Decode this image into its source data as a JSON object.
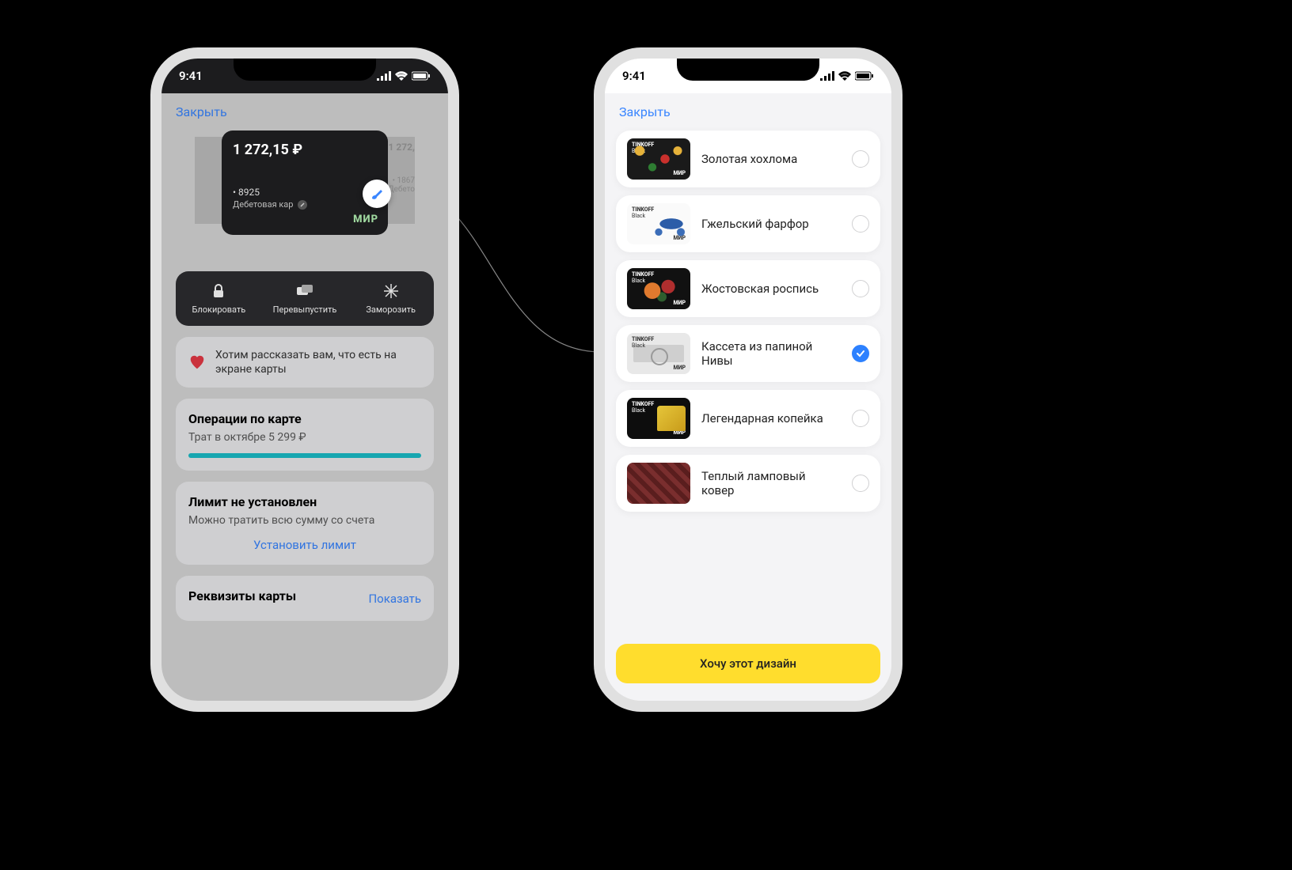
{
  "status": {
    "time": "9:41"
  },
  "close_label": "Закрыть",
  "phone1": {
    "card": {
      "balance": "1 272,15 ₽",
      "number": "• 8925",
      "type": "Дебетовая кар",
      "brand": "МИР",
      "peek_balance": "1 272,",
      "peek_number": "• 1867",
      "peek_type": "Дебето"
    },
    "actions": {
      "block": "Блокировать",
      "reissue": "Перевыпустить",
      "freeze": "Заморозить"
    },
    "banner": "Хотим рассказать вам, что есть на экране карты",
    "ops": {
      "title": "Операции по карте",
      "subtitle": "Трат в октябре 5 299 ₽"
    },
    "limit": {
      "title": "Лимит не установлен",
      "subtitle": "Можно тратить всю сумму со счета",
      "link": "Установить лимит"
    },
    "requisites": {
      "title": "Реквизиты карты",
      "show": "Показать"
    }
  },
  "phone2": {
    "designs": [
      {
        "name": "Золотая хохлома",
        "selected": false,
        "thumb": "t0"
      },
      {
        "name": "Гжельский фарфор",
        "selected": false,
        "thumb": "t1"
      },
      {
        "name": "Жостовская роспись",
        "selected": false,
        "thumb": "t2"
      },
      {
        "name": "Кассета из папиной Нивы",
        "selected": true,
        "thumb": "t3"
      },
      {
        "name": "Легендарная копейка",
        "selected": false,
        "thumb": "t4"
      },
      {
        "name": "Теплый ламповый ковер",
        "selected": false,
        "thumb": "t5"
      }
    ],
    "thumb_brand": "TINKOFF",
    "thumb_sub": "Black",
    "thumb_mir": "МИР",
    "cta": "Хочу этот дизайн"
  }
}
